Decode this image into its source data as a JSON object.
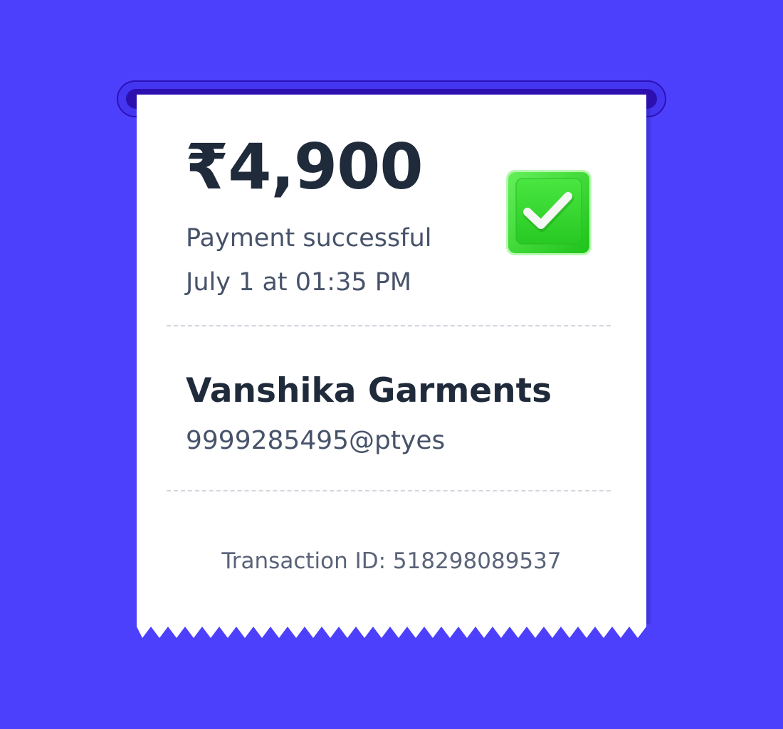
{
  "colors": {
    "background": "#4d40fc",
    "receipt": "#ffffff",
    "primary_text": "#1f2a3b",
    "secondary_text": "#47536a",
    "success": "#2fd42a"
  },
  "payment": {
    "amount": "₹4,900",
    "status": "Payment successful",
    "datetime": "July 1 at 01:35 PM",
    "status_icon": "checkmark-icon"
  },
  "payee": {
    "name": "Vanshika Garments",
    "upi_id": "9999285495@ptyes"
  },
  "transaction": {
    "id_text": "Transaction ID: 518298089537"
  }
}
